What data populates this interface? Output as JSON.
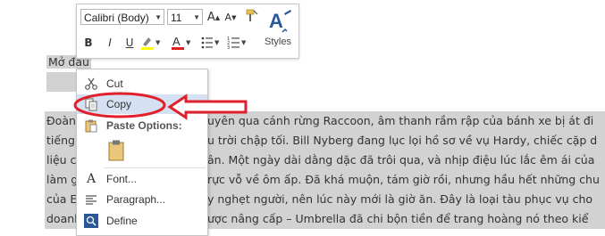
{
  "mini_toolbar": {
    "font_name": "Calibri (Body)",
    "font_size": "11",
    "grow_font": "A",
    "shrink_font": "A",
    "bold": "B",
    "italic": "I",
    "underline": "U",
    "font_color": "A",
    "styles_label": "Styles",
    "highlight_color": "#ffff00",
    "font_color_value": "#e02020",
    "styles_icon_color": "#2b579a"
  },
  "document": {
    "heading": "Mở đầu",
    "lines": [
      {
        "left": "Đoàn",
        "right": "uyên qua cánh rừng Raccoon, âm thanh rầm rập của bánh xe bị át đi"
      },
      {
        "left": "tiếng",
        "right": "u trời chập tối. Bill Nyberg đang lục lọi hồ sơ về vụ Hardy, chiếc cặp d"
      },
      {
        "left": "liệu c",
        "right": "ân. Một ngày dài dằng dặc đã trôi qua, và nhịp điệu lúc lắc êm ái của"
      },
      {
        "left": "làm g",
        "right": "rực vỗ về ôm ấp. Đã khá muộn, tám giờ rồi, nhưng hầu hết những chu"
      },
      {
        "left": "của E",
        "right": "y nghẹt người, nên lúc này mới là giờ ăn. Đây là loại tàu phục vụ cho"
      },
      {
        "left": "doanl",
        "right": "ược nâng cấp – Umbrella đã chi bộn tiền để trang hoàng nó theo kiể"
      }
    ]
  },
  "context_menu": {
    "items": [
      {
        "label": "Cut",
        "icon": "scissors-icon"
      },
      {
        "label": "Copy",
        "icon": "copy-icon"
      },
      {
        "label": "Paste Options:",
        "icon": "clipboard-icon"
      },
      {
        "label": "Font...",
        "icon": "font-icon"
      },
      {
        "label": "Paragraph...",
        "icon": "paragraph-icon"
      },
      {
        "label": "Define",
        "icon": "search-icon"
      }
    ]
  },
  "annotation": {
    "color": "#e0202a"
  }
}
